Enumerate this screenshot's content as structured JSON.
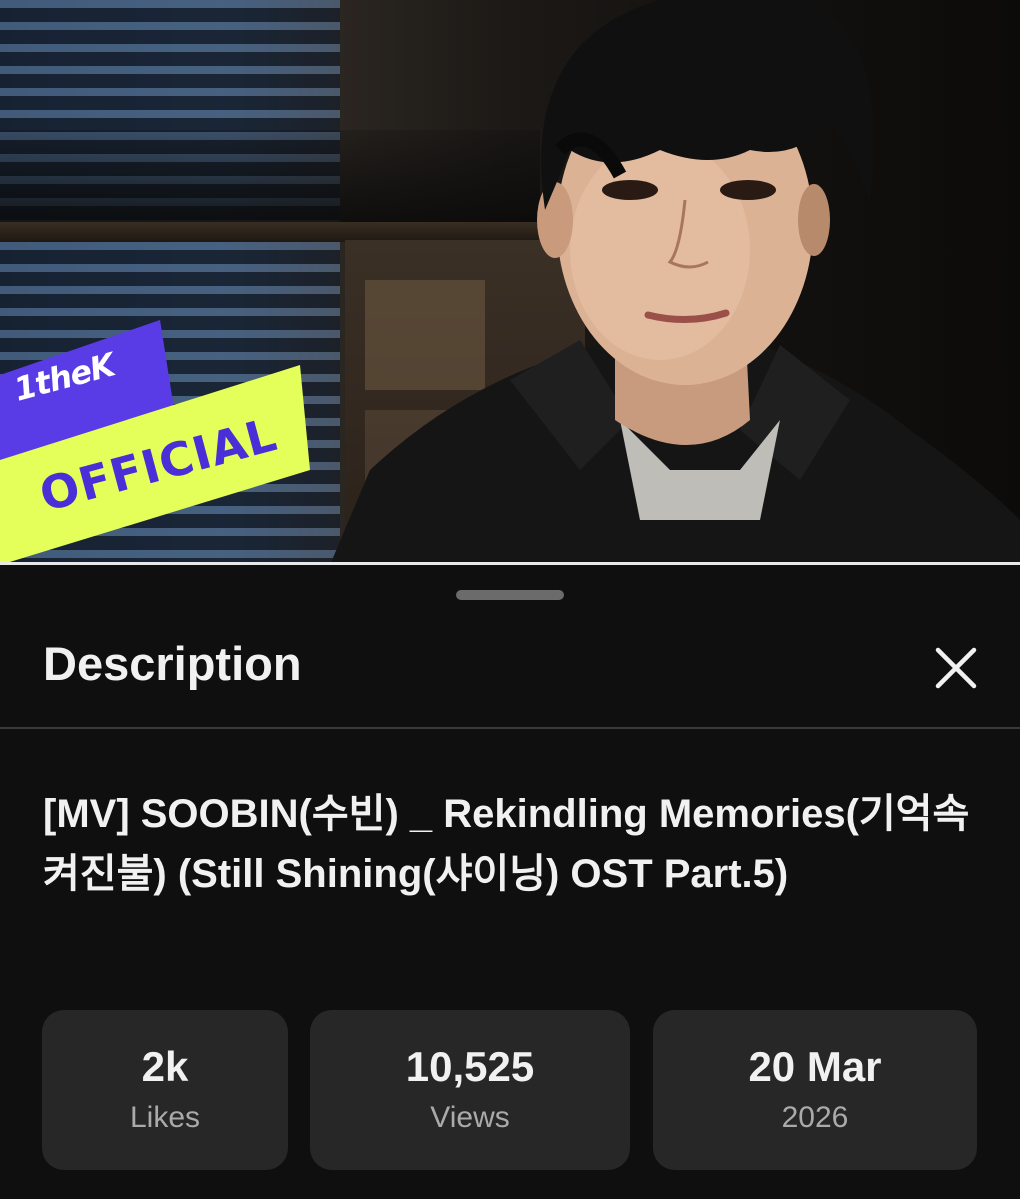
{
  "video": {
    "badge": {
      "top_text": "1theK",
      "main_text": "OFFICIAL"
    }
  },
  "sheet": {
    "title": "Description",
    "close_icon": "close-icon",
    "video_title": "[MV] SOOBIN(수빈) _ Rekindling Memories(기억속 켜진불) (Still Shining(샤이닝) OST Part.5)",
    "stats": [
      {
        "value": "2k",
        "label": "Likes"
      },
      {
        "value": "10,525",
        "label": "Views"
      },
      {
        "value": "20 Mar",
        "label": "2026"
      }
    ]
  },
  "colors": {
    "background": "#0f0f0f",
    "card": "#272727",
    "text_primary": "#f1f1f1",
    "text_secondary": "#aaaaaa",
    "badge_yellow": "#e4ff5a",
    "badge_purple": "#5a3ce6"
  }
}
